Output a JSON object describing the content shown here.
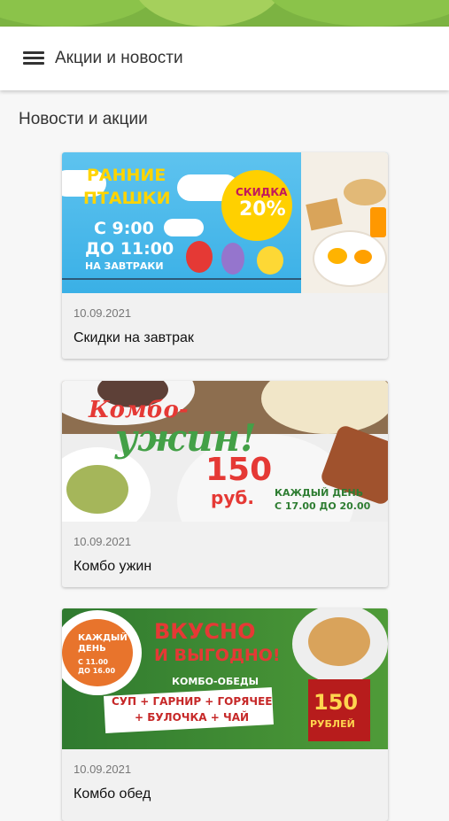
{
  "app": {
    "title": "Акции и новости",
    "accent_color": "#7cb342",
    "menu_icon": "hamburger-menu-icon"
  },
  "section": {
    "title": "Новости и акции"
  },
  "cards": [
    {
      "date": "10.09.2021",
      "title": "Скидки на завтрак",
      "banner": {
        "headline_1": "РАННИЕ",
        "headline_2": "ПТАШКИ",
        "time_1": "С 9:00",
        "time_2": "ДО 11:00",
        "subtitle": "НА ЗАВТРАКИ",
        "badge_1": "СКИДКА",
        "badge_2": "20%"
      }
    },
    {
      "date": "10.09.2021",
      "title": "Комбо ужин",
      "banner": {
        "headline_1": "Комбо-",
        "headline_2": "ужин!",
        "price": "150",
        "price_unit": "руб.",
        "schedule_1": "КАЖДЫЙ ДЕНЬ",
        "schedule_2": "С 17.00 ДО 20.00"
      }
    },
    {
      "date": "10.09.2021",
      "title": "Комбо обед",
      "banner": {
        "day_1": "КАЖДЫЙ",
        "day_2": "ДЕНЬ",
        "hours_1": "С 11.00",
        "hours_2": "ДО 16.00",
        "headline_1": "ВКУСНО",
        "headline_2": "И ВЫГОДНО!",
        "subtitle": "КОМБО-ОБЕДЫ",
        "menu_1": "СУП + ГАРНИР + ГОРЯЧЕЕ",
        "menu_2": "+ БУЛОЧКА + ЧАЙ",
        "price": "150",
        "price_unit": "РУБЛЕЙ"
      }
    }
  ]
}
